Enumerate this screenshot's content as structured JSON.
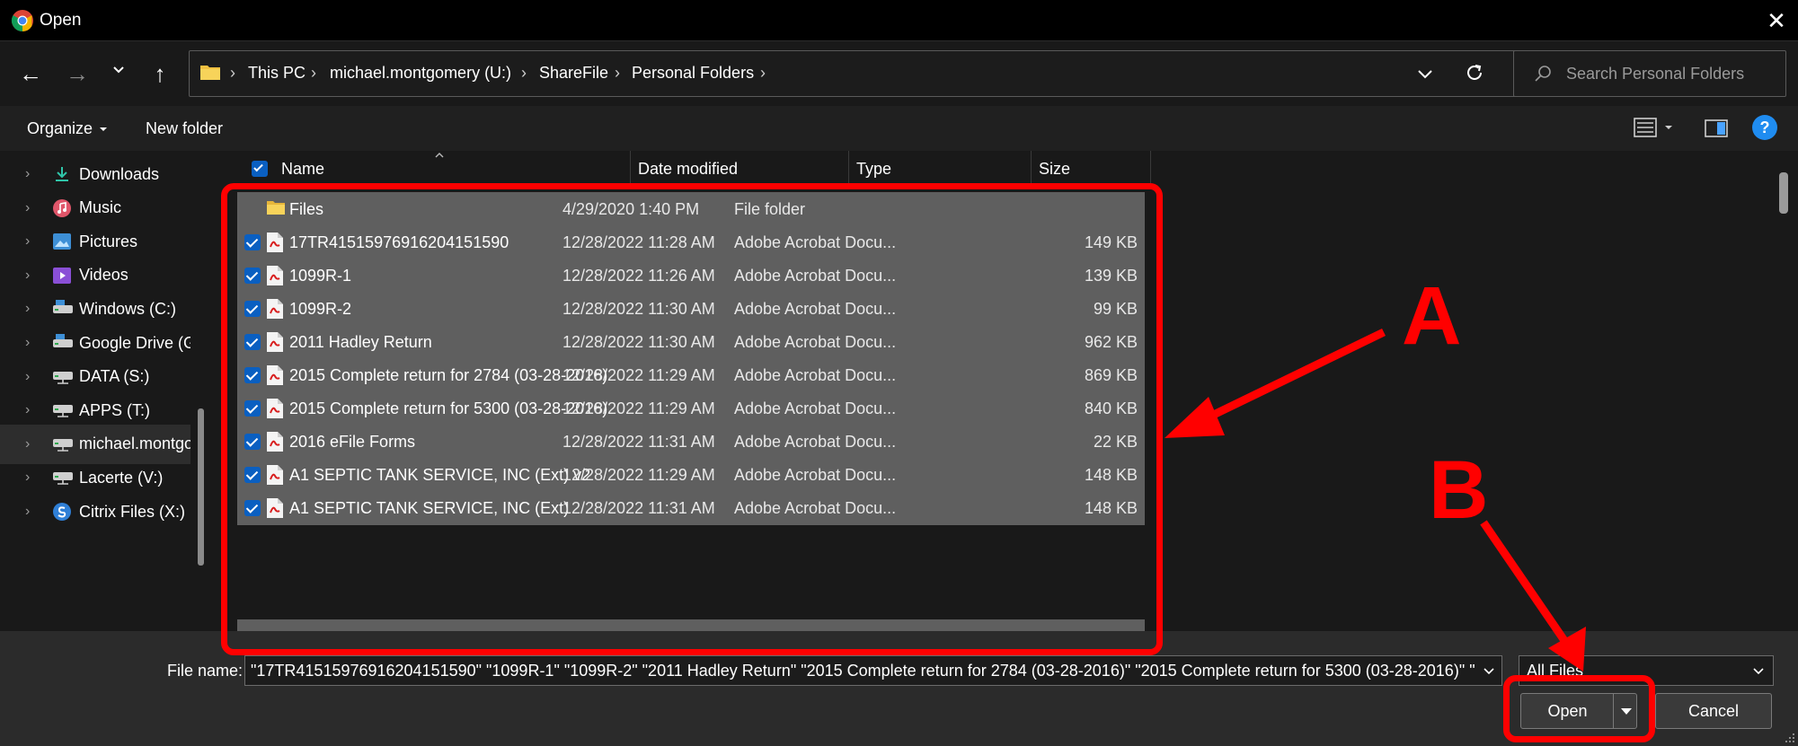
{
  "window": {
    "title": "Open",
    "close_glyph": "✕"
  },
  "nav": {
    "back_icon": "←",
    "forward_icon": "→",
    "recent_icon": "⌄",
    "up_icon": "↑",
    "breadcrumbs": [
      "This PC",
      "michael.montgomery (U:)",
      "ShareFile",
      "Personal Folders"
    ],
    "search_placeholder": "Search Personal Folders"
  },
  "toolbar": {
    "organize_label": "Organize",
    "new_folder_label": "New folder",
    "help_glyph": "?"
  },
  "sidebar": {
    "items": [
      {
        "label": "Downloads",
        "icon": "download-icon"
      },
      {
        "label": "Music",
        "icon": "music-icon"
      },
      {
        "label": "Pictures",
        "icon": "pictures-icon"
      },
      {
        "label": "Videos",
        "icon": "videos-icon"
      },
      {
        "label": "Windows (C:)",
        "icon": "drive-icon"
      },
      {
        "label": "Google Drive (G",
        "icon": "drive-icon"
      },
      {
        "label": "DATA (S:)",
        "icon": "network-drive-icon"
      },
      {
        "label": "APPS (T:)",
        "icon": "network-drive-icon"
      },
      {
        "label": "michael.montgo",
        "icon": "network-drive-icon"
      },
      {
        "label": "Lacerte (V:)",
        "icon": "network-drive-icon"
      },
      {
        "label": "Citrix Files (X:)",
        "icon": "citrix-icon"
      }
    ]
  },
  "columns": {
    "name": "Name",
    "date": "Date modified",
    "type": "Type",
    "size": "Size"
  },
  "files": [
    {
      "name": "Files",
      "date": "4/29/2020 1:40 PM",
      "type": "File folder",
      "size": "",
      "kind": "folder",
      "checked": false
    },
    {
      "name": "17TR41515976916204151590",
      "date": "12/28/2022 11:28 AM",
      "type": "Adobe Acrobat Docu...",
      "size": "149 KB",
      "kind": "pdf",
      "checked": true
    },
    {
      "name": "1099R-1",
      "date": "12/28/2022 11:26 AM",
      "type": "Adobe Acrobat Docu...",
      "size": "139 KB",
      "kind": "pdf",
      "checked": true
    },
    {
      "name": "1099R-2",
      "date": "12/28/2022 11:30 AM",
      "type": "Adobe Acrobat Docu...",
      "size": "99 KB",
      "kind": "pdf",
      "checked": true
    },
    {
      "name": "2011 Hadley Return",
      "date": "12/28/2022 11:30 AM",
      "type": "Adobe Acrobat Docu...",
      "size": "962 KB",
      "kind": "pdf",
      "checked": true
    },
    {
      "name": "2015 Complete return for 2784 (03-28-2016)",
      "date": "12/28/2022 11:29 AM",
      "type": "Adobe Acrobat Docu...",
      "size": "869 KB",
      "kind": "pdf",
      "checked": true
    },
    {
      "name": "2015 Complete return for 5300 (03-28-2016)",
      "date": "12/28/2022 11:29 AM",
      "type": "Adobe Acrobat Docu...",
      "size": "840 KB",
      "kind": "pdf",
      "checked": true
    },
    {
      "name": "2016 eFile Forms",
      "date": "12/28/2022 11:31 AM",
      "type": "Adobe Acrobat Docu...",
      "size": "22 KB",
      "kind": "pdf",
      "checked": true
    },
    {
      "name": "A1 SEPTIC TANK SERVICE, INC (Ext) v2",
      "date": "12/28/2022 11:29 AM",
      "type": "Adobe Acrobat Docu...",
      "size": "148 KB",
      "kind": "pdf",
      "checked": true
    },
    {
      "name": "A1 SEPTIC TANK SERVICE, INC (Ext)",
      "date": "12/28/2022 11:31 AM",
      "type": "Adobe Acrobat Docu...",
      "size": "148 KB",
      "kind": "pdf",
      "checked": true
    }
  ],
  "bottom": {
    "filename_label": "File name:",
    "filename_value": "\"17TR41515976916204151590\" \"1099R-1\" \"1099R-2\" \"2011 Hadley Return\" \"2015 Complete return for 2784 (03-28-2016)\" \"2015 Complete return for 5300 (03-28-2016)\" \"",
    "filetype_value": "All Files",
    "open_label": "Open",
    "cancel_label": "Cancel"
  },
  "annotations": {
    "a_label": "A",
    "b_label": "B",
    "color": "#ff0000"
  },
  "colors": {
    "accent": "#0a5fc1",
    "row_selected": "#5f5f5f",
    "background": "#191919"
  }
}
